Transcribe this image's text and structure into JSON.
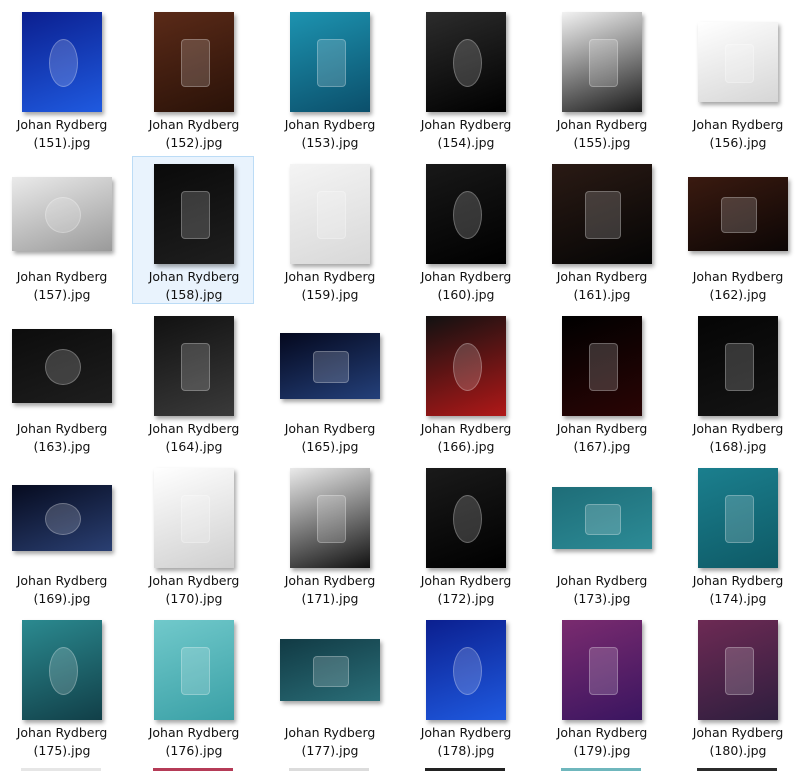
{
  "files": [
    {
      "line1": "Johan Rydberg",
      "line2": "(151).jpg",
      "icon": "image-file-icon",
      "colors": [
        "#0b1f8f",
        "#1f5ae0"
      ],
      "selected": false
    },
    {
      "line1": "Johan Rydberg",
      "line2": "(152).jpg",
      "icon": "image-file-icon",
      "colors": [
        "#5a2a18",
        "#2a1208"
      ],
      "selected": false
    },
    {
      "line1": "Johan Rydberg",
      "line2": "(153).jpg",
      "icon": "image-file-icon",
      "colors": [
        "#1d93b0",
        "#0b4f6b"
      ],
      "selected": false
    },
    {
      "line1": "Johan Rydberg",
      "line2": "(154).jpg",
      "icon": "image-file-icon",
      "colors": [
        "#2c2c2c",
        "#000000"
      ],
      "selected": false
    },
    {
      "line1": "Johan Rydberg",
      "line2": "(155).jpg",
      "icon": "image-file-icon",
      "colors": [
        "#f2f2f2",
        "#1a1a1a"
      ],
      "selected": false
    },
    {
      "line1": "Johan Rydberg",
      "line2": "(156).jpg",
      "icon": "image-file-icon",
      "colors": [
        "#ffffff",
        "#d6d6d6"
      ],
      "selected": false
    },
    {
      "line1": "Johan Rydberg",
      "line2": "(157).jpg",
      "icon": "image-file-icon",
      "colors": [
        "#eaeaea",
        "#9a9a9a"
      ],
      "selected": false
    },
    {
      "line1": "Johan Rydberg",
      "line2": "(158).jpg",
      "icon": "image-file-icon",
      "colors": [
        "#0a0a0a",
        "#1e1e1e"
      ],
      "selected": true
    },
    {
      "line1": "Johan Rydberg",
      "line2": "(159).jpg",
      "icon": "image-file-icon",
      "colors": [
        "#f4f4f4",
        "#d8d8d8"
      ],
      "selected": false
    },
    {
      "line1": "Johan Rydberg",
      "line2": "(160).jpg",
      "icon": "image-file-icon",
      "colors": [
        "#181818",
        "#000000"
      ],
      "selected": false
    },
    {
      "line1": "Johan Rydberg",
      "line2": "(161).jpg",
      "icon": "image-file-icon",
      "colors": [
        "#2a1a14",
        "#050505"
      ],
      "selected": false
    },
    {
      "line1": "Johan Rydberg",
      "line2": "(162).jpg",
      "icon": "image-file-icon",
      "colors": [
        "#3a1a10",
        "#0c0605"
      ],
      "selected": false
    },
    {
      "line1": "Johan Rydberg",
      "line2": "(163).jpg",
      "icon": "image-file-icon",
      "colors": [
        "#0c0c0c",
        "#1e1e1e"
      ],
      "selected": false
    },
    {
      "line1": "Johan Rydberg",
      "line2": "(164).jpg",
      "icon": "image-file-icon",
      "colors": [
        "#111111",
        "#3a3a3a"
      ],
      "selected": false
    },
    {
      "line1": "Johan Rydberg",
      "line2": "(165).jpg",
      "icon": "image-file-icon",
      "colors": [
        "#04081e",
        "#24407a"
      ],
      "selected": false
    },
    {
      "line1": "Johan Rydberg",
      "line2": "(166).jpg",
      "icon": "image-file-icon",
      "colors": [
        "#111111",
        "#b01818"
      ],
      "selected": false
    },
    {
      "line1": "Johan Rydberg",
      "line2": "(167).jpg",
      "icon": "image-file-icon",
      "colors": [
        "#000000",
        "#2a0505"
      ],
      "selected": false
    },
    {
      "line1": "Johan Rydberg",
      "line2": "(168).jpg",
      "icon": "image-file-icon",
      "colors": [
        "#050505",
        "#141414"
      ],
      "selected": false
    },
    {
      "line1": "Johan Rydberg",
      "line2": "(169).jpg",
      "icon": "image-file-icon",
      "colors": [
        "#060b1f",
        "#2a3f72"
      ],
      "selected": false
    },
    {
      "line1": "Johan Rydberg",
      "line2": "(170).jpg",
      "icon": "image-file-icon",
      "colors": [
        "#ffffff",
        "#cfcfcf"
      ],
      "selected": false
    },
    {
      "line1": "Johan Rydberg",
      "line2": "(171).jpg",
      "icon": "image-file-icon",
      "colors": [
        "#eaeaea",
        "#111111"
      ],
      "selected": false
    },
    {
      "line1": "Johan Rydberg",
      "line2": "(172).jpg",
      "icon": "image-file-icon",
      "colors": [
        "#1a1a1a",
        "#000000"
      ],
      "selected": false
    },
    {
      "line1": "Johan Rydberg",
      "line2": "(173).jpg",
      "icon": "image-file-icon",
      "colors": [
        "#1e6d78",
        "#2c8b96"
      ],
      "selected": false
    },
    {
      "line1": "Johan Rydberg",
      "line2": "(174).jpg",
      "icon": "image-file-icon",
      "colors": [
        "#1b7f8e",
        "#0e5a66"
      ],
      "selected": false
    },
    {
      "line1": "Johan Rydberg",
      "line2": "(175).jpg",
      "icon": "image-file-icon",
      "colors": [
        "#2b8a90",
        "#113f48"
      ],
      "selected": false
    },
    {
      "line1": "Johan Rydberg",
      "line2": "(176).jpg",
      "icon": "image-file-icon",
      "colors": [
        "#71c9cb",
        "#3aa0a6"
      ],
      "selected": false
    },
    {
      "line1": "Johan Rydberg",
      "line2": "(177).jpg",
      "icon": "image-file-icon",
      "colors": [
        "#113a44",
        "#2a6e78"
      ],
      "selected": false
    },
    {
      "line1": "Johan Rydberg",
      "line2": "(178).jpg",
      "icon": "image-file-icon",
      "colors": [
        "#0b1f8f",
        "#1f5ae0"
      ],
      "selected": false
    },
    {
      "line1": "Johan Rydberg",
      "line2": "(179).jpg",
      "icon": "image-file-icon",
      "colors": [
        "#7a2b6f",
        "#3a1560"
      ],
      "selected": false
    },
    {
      "line1": "Johan Rydberg",
      "line2": "(180).jpg",
      "icon": "image-file-icon",
      "colors": [
        "#6d2a54",
        "#2e1e3e"
      ],
      "selected": false
    }
  ],
  "next_row_peek_colors": [
    "#e6e6e6",
    "#b53b57",
    "#dcdcdc",
    "#222222",
    "#6fb7bd",
    "#2b2b2b"
  ]
}
